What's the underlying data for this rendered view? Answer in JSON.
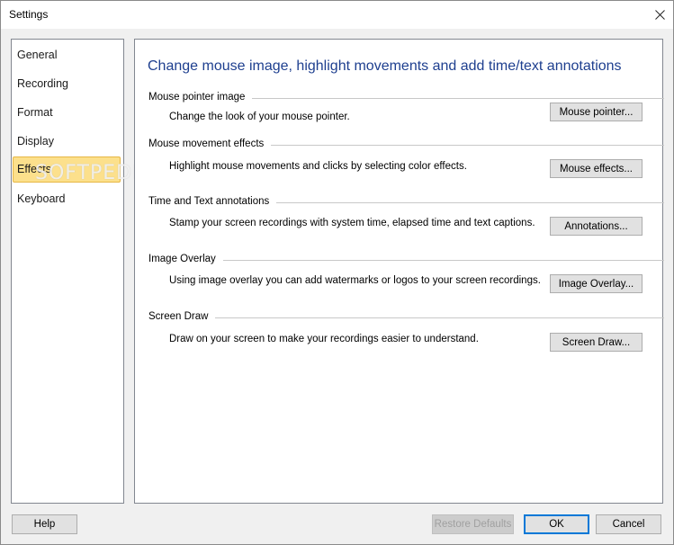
{
  "window": {
    "title": "Settings"
  },
  "sidebar": {
    "items": [
      {
        "label": "General"
      },
      {
        "label": "Recording"
      },
      {
        "label": "Format"
      },
      {
        "label": "Display"
      },
      {
        "label": "Effects",
        "selected": true
      },
      {
        "label": "Keyboard"
      }
    ],
    "watermark": "SOFTPEDIA"
  },
  "content": {
    "heading": "Change mouse image, highlight movements and add time/text annotations",
    "sections": [
      {
        "title": "Mouse pointer image",
        "description": "Change the look of your mouse pointer.",
        "button": "Mouse pointer..."
      },
      {
        "title": "Mouse movement effects",
        "description": "Highlight mouse movements and clicks by selecting color effects.",
        "button": "Mouse effects..."
      },
      {
        "title": "Time and Text annotations",
        "description": "Stamp your screen recordings with system time, elapsed time and text captions.",
        "button": "Annotations..."
      },
      {
        "title": "Image Overlay",
        "description": "Using image overlay you can add watermarks or logos to your screen recordings.",
        "button": "Image Overlay..."
      },
      {
        "title": "Screen Draw",
        "description": "Draw on your screen to make your recordings easier to understand.",
        "button": "Screen Draw..."
      }
    ]
  },
  "footer": {
    "help": "Help",
    "restore_defaults": "Restore Defaults",
    "ok": "OK",
    "cancel": "Cancel"
  },
  "colors": {
    "heading": "#1e3f8f",
    "selected_bg": "#fce08c",
    "selected_border": "#e7b745",
    "ok_focus_border": "#0078d7"
  }
}
